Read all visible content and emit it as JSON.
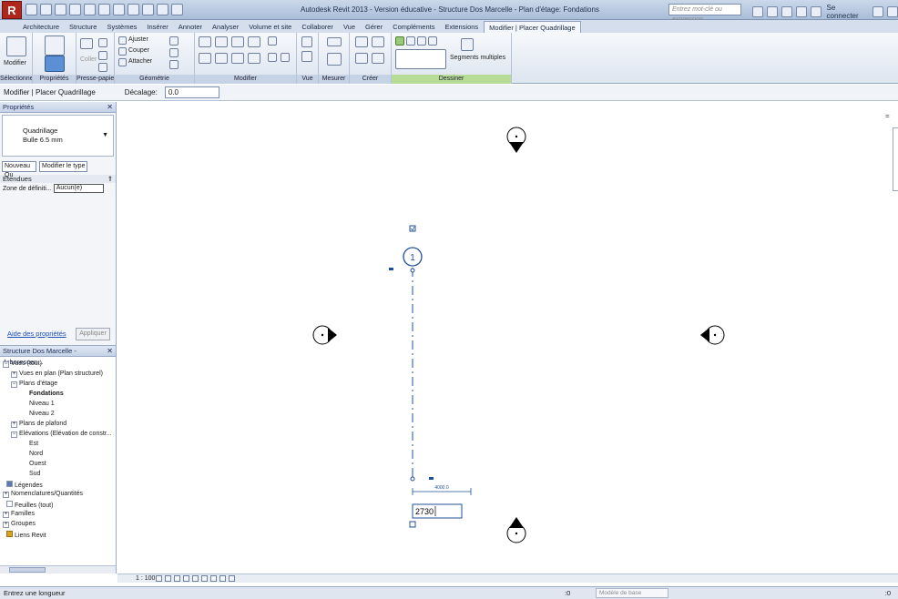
{
  "title_bar": {
    "logo": "R",
    "title": "Autodesk Revit 2013 - Version éducative -  Structure Dos Marcelle - Plan d'étage: Fondations",
    "search_placeholder": "Entrez mot-clé ou expression",
    "connect_label": "Se connecter"
  },
  "ribbon_tabs": [
    "Architecture",
    "Structure",
    "Systèmes",
    "Insérer",
    "Annoter",
    "Analyser",
    "Volume et site",
    "Collaborer",
    "Vue",
    "Gérer",
    "Compléments",
    "Extensions",
    "Modifier | Placer Quadrillage"
  ],
  "ribbon": {
    "modify_label": "Modifier",
    "properties_label": "Propriétés",
    "paste_label": "Coller",
    "geometry_buttons": [
      "Ajuster",
      "Couper",
      "Attacher"
    ],
    "segments_label": "Segments multiples",
    "panels": [
      "Sélectionner",
      "Propriétés",
      "Presse-papiers",
      "Géométrie",
      "Modifier",
      "Vue",
      "Mesurer",
      "Créer",
      "Dessiner"
    ]
  },
  "options_bar": {
    "context": "Modifier | Placer Quadrillage",
    "offset_label": "Décalage:",
    "offset_value": "0.0"
  },
  "properties": {
    "header": "Propriétés",
    "type_name": "Quadrillage",
    "type_size": "Bulle 6.5 mm",
    "new_dropdown": "Nouveau Qu",
    "edit_type": "Modifier le type",
    "section": "Etendues",
    "scope_label": "Zone de définiti...",
    "scope_value": "Aucun(e)",
    "help_link": "Aide des propriétés",
    "apply": "Appliquer"
  },
  "browser": {
    "header": "Structure Dos Marcelle - Arborescen...",
    "items": [
      {
        "label": "Vues (tout)"
      },
      {
        "label": "Vues en plan (Plan structurel)"
      },
      {
        "label": "Plans d'étage"
      },
      {
        "label": "Fondations"
      },
      {
        "label": "Niveau 1"
      },
      {
        "label": "Niveau 2"
      },
      {
        "label": "Plans de plafond"
      },
      {
        "label": "Elévations (Elévation de constr..."
      },
      {
        "label": "Est"
      },
      {
        "label": "Nord"
      },
      {
        "label": "Ouest"
      },
      {
        "label": "Sud"
      },
      {
        "label": "Légendes"
      },
      {
        "label": "Nomenclatures/Quantités"
      },
      {
        "label": "Feuilles (tout)"
      },
      {
        "label": "Familles"
      },
      {
        "label": "Groupes"
      },
      {
        "label": "Liens Revit"
      }
    ]
  },
  "canvas": {
    "grid_bubble_label": "1",
    "length_input": "2730",
    "temp_dim": "4000.0"
  },
  "view_bar": {
    "scale": "1 : 100"
  },
  "status_bar": {
    "prompt": "Entrez une longueur",
    "coord": ":0",
    "model": "Modèle de base",
    "filter": ":0"
  },
  "colors": {
    "accent": "#1f4f99",
    "context_tab": "#bfe3a0"
  }
}
